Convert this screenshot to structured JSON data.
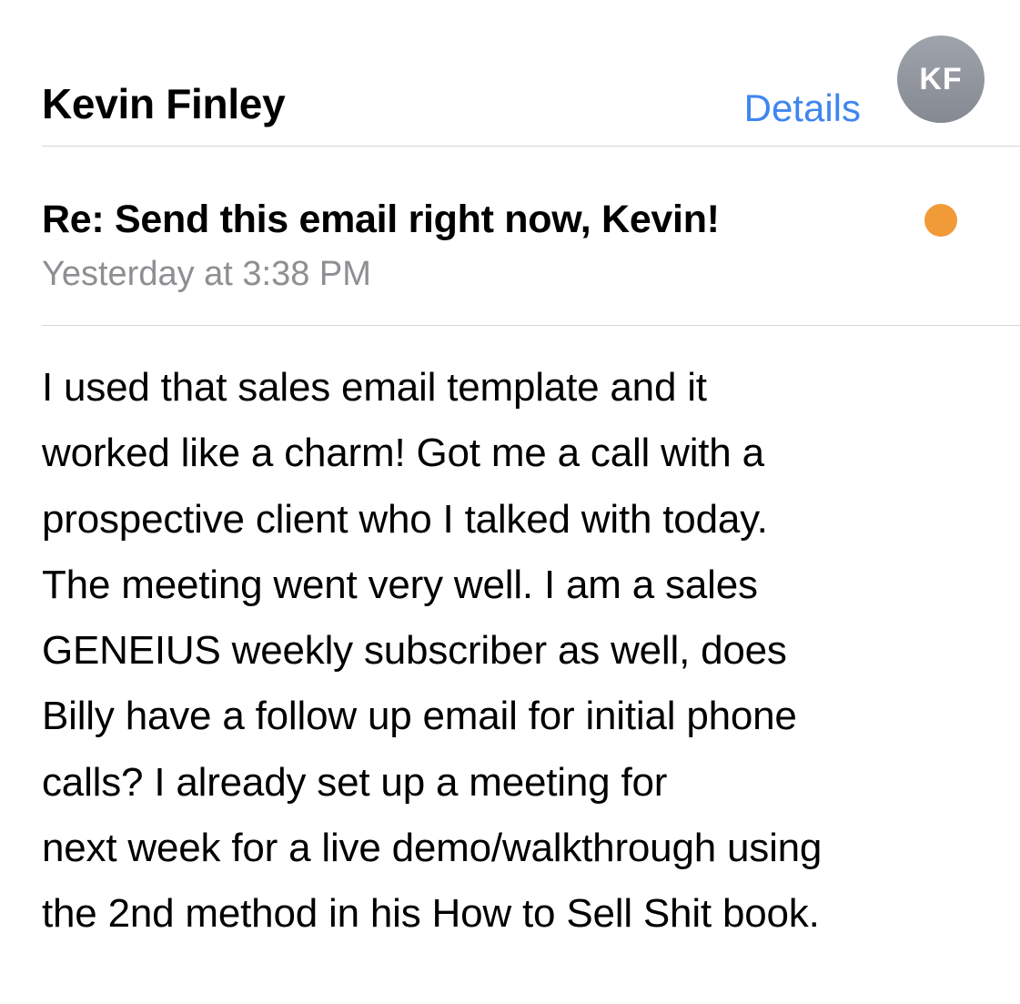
{
  "header": {
    "sender_name": "Kevin Finley",
    "details_label": "Details",
    "avatar_initials": "KF"
  },
  "message": {
    "subject": "Re: Send this email right now, Kevin!",
    "timestamp": "Yesterday at 3:38 PM",
    "unread": true,
    "body_lines": [
      "I used that sales email template and it",
      "worked like a charm! Got me a call with a",
      "prospective client who I talked with today.",
      "The meeting went very well. I am a sales",
      "GENEIUS weekly subscriber as well, does",
      "Billy have a follow up email for initial phone",
      "calls? I already set up a meeting for",
      "next week for a live demo/walkthrough using",
      "the 2nd method in his How to Sell Shit book."
    ]
  },
  "colors": {
    "link": "#3f86f0",
    "unread_dot": "#f19a38",
    "secondary_text": "#8e8e93",
    "avatar_bg": "#8f939a"
  }
}
